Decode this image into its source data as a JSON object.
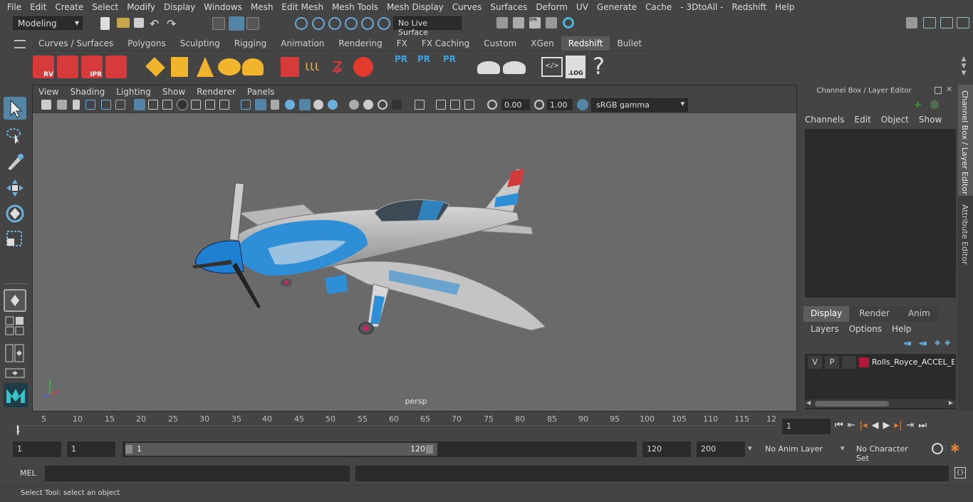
{
  "menubar": {
    "items": [
      "File",
      "Edit",
      "Create",
      "Select",
      "Modify",
      "Display",
      "Windows",
      "Mesh",
      "Edit Mesh",
      "Mesh Tools",
      "Mesh Display",
      "Curves",
      "Surfaces",
      "Deform",
      "UV",
      "Generate",
      "Cache",
      "- 3DtoAll -",
      "Redshift",
      "Help"
    ]
  },
  "statusline": {
    "workspace": "Modeling",
    "live_surface": "No Live Surface"
  },
  "shelf": {
    "tabs": [
      "Curves / Surfaces",
      "Polygons",
      "Sculpting",
      "Rigging",
      "Animation",
      "Rendering",
      "FX",
      "FX Caching",
      "Custom",
      "XGen",
      "Redshift",
      "Bullet"
    ],
    "active_tab": "Redshift",
    "icon_labels": [
      "RV",
      "IPR",
      "PR",
      "PR",
      "PR",
      ".LOG",
      "?"
    ]
  },
  "panel": {
    "menus": [
      "View",
      "Shading",
      "Lighting",
      "Show",
      "Renderer",
      "Panels"
    ],
    "exposure": "0.00",
    "gamma": "1.00",
    "color_space": "sRGB gamma",
    "camera_label": "persp"
  },
  "channel_box": {
    "title": "Channel Box / Layer Editor",
    "menus": [
      "Channels",
      "Edit",
      "Object",
      "Show"
    ],
    "layer_tabs": [
      "Display",
      "Render",
      "Anim"
    ],
    "active_layer_tab": "Display",
    "layer_menus": [
      "Layers",
      "Options",
      "Help"
    ],
    "layer": {
      "v": "V",
      "p": "P",
      "name": "Rolls_Royce_ACCEL_Ele",
      "color": "#b0173a"
    }
  },
  "side_tabs": [
    "Channel Box / Layer Editor",
    "Attribute Editor"
  ],
  "timeline": {
    "ticks": [
      "5",
      "10",
      "15",
      "20",
      "25",
      "30",
      "35",
      "40",
      "45",
      "50",
      "55",
      "60",
      "65",
      "70",
      "75",
      "80",
      "85",
      "90",
      "95",
      "100",
      "105",
      "110",
      "115",
      "12"
    ],
    "start_marker": "1",
    "current_frame": "1"
  },
  "range": {
    "start": "1",
    "anim_start": "1",
    "slider_start": "1",
    "slider_end": "120",
    "end": "120",
    "anim_end": "200",
    "anim_layer": "No Anim Layer",
    "character_set": "No Character Set"
  },
  "mel": {
    "label": "MEL"
  },
  "help": {
    "text": "Select Tool: select an object"
  },
  "colors": {
    "accent_blue": "#2f8fd6",
    "viewport_bg": "#6a6a6a",
    "active_tool": "#5285a6"
  }
}
